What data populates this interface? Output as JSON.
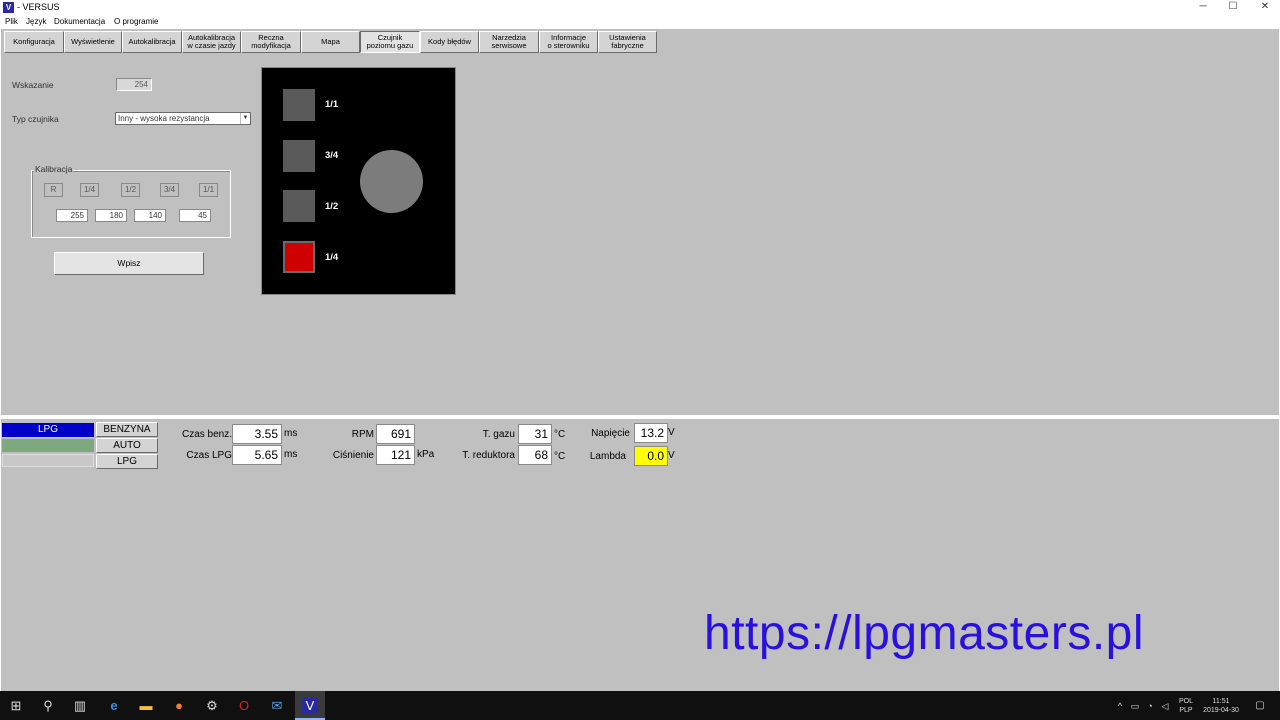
{
  "window": {
    "title": "- VERSUS",
    "app_icon": "V",
    "controls": {
      "minimize": "─",
      "maximize": "☐",
      "close": "✕"
    }
  },
  "menu": [
    "Plik",
    "Język",
    "Dokumentacja",
    "O programie"
  ],
  "tabs": [
    "Konfiguracja",
    "Wyświetlenie",
    "Autokalibracja",
    "Autokalibracja\nw czasie jazdy",
    "Reczna\nmodyfikacja",
    "Mapa",
    "Czujnik\npoziomu gazu",
    "Kody błędów",
    "Narzedzia\nserwisowe",
    "Informacje\no sterowniku",
    "Ustawienia\nfabryczne"
  ],
  "active_tab_index": 6,
  "sensor": {
    "indication_label": "Wskazanie",
    "indication_value": "254",
    "type_label": "Typ czujnika",
    "type_value": "Inny - wysoka rezystancja",
    "calibration": {
      "title": "Kalibracja",
      "buttons": [
        "R",
        "1/4",
        "1/2",
        "3/4",
        "1/1"
      ],
      "values": [
        "255",
        "180",
        "140",
        "45"
      ]
    },
    "write_button": "Wpisz"
  },
  "level_panel": {
    "levels": [
      {
        "label": "1/1",
        "on": false
      },
      {
        "label": "3/4",
        "on": false
      },
      {
        "label": "1/2",
        "on": false
      },
      {
        "label": "1/4",
        "on": true
      }
    ],
    "gauge_icon": "gauge-circle-icon",
    "led_on_color": "#d00000"
  },
  "status": {
    "fuel_indicator": {
      "label": "LPG",
      "color": "#0000c8"
    },
    "mode_buttons": [
      "BENZYNA",
      "AUTO",
      "LPG"
    ],
    "auto_indicator_color": "#7ea87e",
    "metrics": {
      "czas_benz": {
        "label": "Czas benz.",
        "value": "3.55",
        "unit": "ms"
      },
      "czas_lpg": {
        "label": "Czas LPG",
        "value": "5.65",
        "unit": "ms"
      },
      "rpm": {
        "label": "RPM",
        "value": "691"
      },
      "cisnienie": {
        "label": "Ciśnienie",
        "value": "121",
        "unit": "kPa"
      },
      "t_gazu": {
        "label": "T. gazu",
        "value": "31",
        "unit": "°C"
      },
      "t_reduktora": {
        "label": "T. reduktora",
        "value": "68",
        "unit": "°C"
      },
      "napiecie": {
        "label": "Napięcie",
        "value": "13.2",
        "unit": "V"
      },
      "lambda": {
        "label": "Lambda",
        "value": "0.0",
        "unit": "V",
        "highlight": "#ffff00"
      }
    }
  },
  "watermark": "https://lpgmasters.pl",
  "taskbar": {
    "icons": [
      "windows-start-icon",
      "search-icon",
      "task-view-icon",
      "edge-icon",
      "file-explorer-icon",
      "firefox-icon",
      "settings-icon",
      "opera-icon",
      "mail-icon",
      "versus-app-icon"
    ],
    "tray": {
      "lang_top": "POL",
      "lang_bottom": "PLP",
      "time": "11:51",
      "date": "2019-04-30"
    }
  }
}
